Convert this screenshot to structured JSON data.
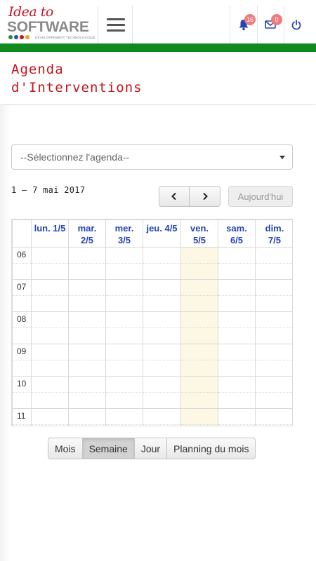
{
  "brand": {
    "script": "Idea to",
    "main": "SOFTWARE",
    "tagline": "DÉVELOPPEMENT TECHNOLOGIQUE",
    "dot_colors": [
      "#2b8a3e",
      "#2451b8",
      "#c4161c",
      "#f0a020"
    ]
  },
  "header": {
    "notifications_count": "16",
    "messages_count": "0",
    "accent_green": "#0f8a1e",
    "icon_blue": "#2544b8"
  },
  "page": {
    "title_line1": "Agenda",
    "title_line2": "d'Interventions"
  },
  "agenda_select": {
    "value": "--Sélectionnez l'agenda--"
  },
  "calendar": {
    "range": "1 — 7 mai 2017",
    "prev_icon": "chevron-left-icon",
    "next_icon": "chevron-right-icon",
    "today_label": "Aujourd'hui",
    "days": [
      {
        "l1": "lun. 1/5",
        "l2": ""
      },
      {
        "l1": "mar.",
        "l2": "2/5"
      },
      {
        "l1": "mer.",
        "l2": "3/5"
      },
      {
        "l1": "jeu. 4/5",
        "l2": ""
      },
      {
        "l1": "ven.",
        "l2": "5/5"
      },
      {
        "l1": "sam.",
        "l2": "6/5"
      },
      {
        "l1": "dim.",
        "l2": "7/5"
      }
    ],
    "hours": [
      "06",
      "07",
      "08",
      "09",
      "10",
      "11"
    ],
    "highlight_color": "#fcf8e3"
  },
  "views": {
    "month": "Mois",
    "week": "Semaine",
    "day": "Jour",
    "planning": "Planning du mois"
  }
}
